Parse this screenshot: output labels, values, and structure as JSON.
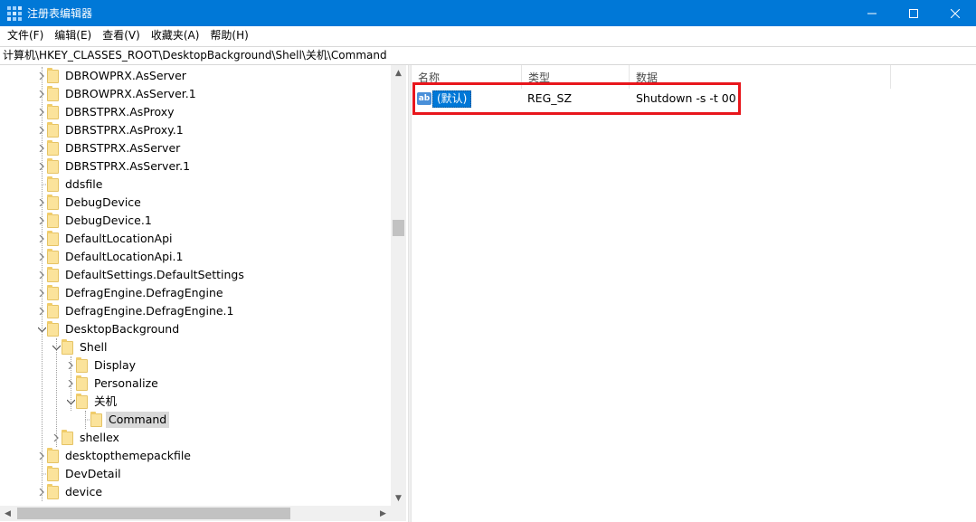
{
  "window": {
    "title": "注册表编辑器"
  },
  "menu": [
    "文件(F)",
    "编辑(E)",
    "查看(V)",
    "收藏夹(A)",
    "帮助(H)"
  ],
  "address": "计算机\\HKEY_CLASSES_ROOT\\DesktopBackground\\Shell\\关机\\Command",
  "tree": [
    {
      "label": "DBROWPRX.AsServer",
      "level": 0,
      "toggle": "collapsed"
    },
    {
      "label": "DBROWPRX.AsServer.1",
      "level": 0,
      "toggle": "collapsed"
    },
    {
      "label": "DBRSTPRX.AsProxy",
      "level": 0,
      "toggle": "collapsed"
    },
    {
      "label": "DBRSTPRX.AsProxy.1",
      "level": 0,
      "toggle": "collapsed"
    },
    {
      "label": "DBRSTPRX.AsServer",
      "level": 0,
      "toggle": "collapsed"
    },
    {
      "label": "DBRSTPRX.AsServer.1",
      "level": 0,
      "toggle": "collapsed"
    },
    {
      "label": "ddsfile",
      "level": 0,
      "toggle": "none"
    },
    {
      "label": "DebugDevice",
      "level": 0,
      "toggle": "collapsed"
    },
    {
      "label": "DebugDevice.1",
      "level": 0,
      "toggle": "collapsed"
    },
    {
      "label": "DefaultLocationApi",
      "level": 0,
      "toggle": "collapsed"
    },
    {
      "label": "DefaultLocationApi.1",
      "level": 0,
      "toggle": "collapsed"
    },
    {
      "label": "DefaultSettings.DefaultSettings",
      "level": 0,
      "toggle": "collapsed"
    },
    {
      "label": "DefragEngine.DefragEngine",
      "level": 0,
      "toggle": "collapsed"
    },
    {
      "label": "DefragEngine.DefragEngine.1",
      "level": 0,
      "toggle": "collapsed"
    },
    {
      "label": "DesktopBackground",
      "level": 0,
      "toggle": "expanded"
    },
    {
      "label": "Shell",
      "level": 1,
      "toggle": "expanded"
    },
    {
      "label": "Display",
      "level": 2,
      "toggle": "collapsed"
    },
    {
      "label": "Personalize",
      "level": 2,
      "toggle": "collapsed"
    },
    {
      "label": "关机",
      "level": 2,
      "toggle": "expanded"
    },
    {
      "label": "Command",
      "level": 3,
      "toggle": "none",
      "selected": true
    },
    {
      "label": "shellex",
      "level": 1,
      "toggle": "collapsed"
    },
    {
      "label": "desktopthemepackfile",
      "level": 0,
      "toggle": "collapsed"
    },
    {
      "label": "DevDetail",
      "level": 0,
      "toggle": "none"
    },
    {
      "label": "device",
      "level": 0,
      "toggle": "collapsed"
    }
  ],
  "columns": {
    "name": "名称",
    "type": "类型",
    "data": "数据"
  },
  "values": [
    {
      "icon": "ab",
      "name": "(默认)",
      "type": "REG_SZ",
      "data": "Shutdown -s -t 00"
    }
  ],
  "colors": {
    "titlebar": "#0078d7",
    "highlight": "#e8161c",
    "folder": "#fbe39b"
  }
}
